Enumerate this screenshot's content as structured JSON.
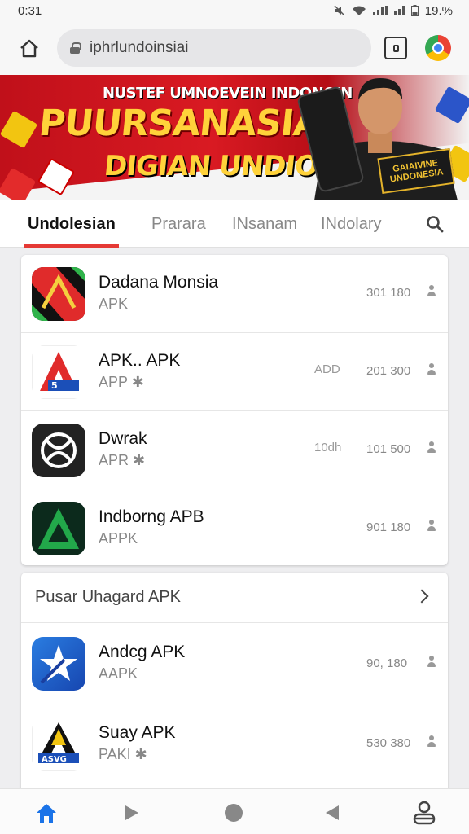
{
  "status_bar": {
    "time": "0:31",
    "battery": "19.%"
  },
  "browser": {
    "url": "iphrlundoinsiai"
  },
  "banner": {
    "line1": "NUSTEF UMNOEVEIN INDONOIN",
    "line2": "PUURSANASIA!",
    "line3": "DIGIAN UNDIOVEIN!",
    "badge": "GAIAIVINE UNDONESIA"
  },
  "tabs": [
    {
      "label": "Undolesian",
      "active": true
    },
    {
      "label": "Prarara",
      "active": false
    },
    {
      "label": "INsanam",
      "active": false
    },
    {
      "label": "INdolary",
      "active": false
    }
  ],
  "apps_card1": [
    {
      "name": "Dadana Monsia",
      "sub": "APK",
      "extra": "",
      "count": "301 180",
      "icon": "red-x-game-icon"
    },
    {
      "name": "APK.. APK",
      "sub": "APP ✱",
      "extra": "ADD",
      "count": "201 300",
      "icon": "red-a-logo-icon"
    },
    {
      "name": "Dwrak",
      "sub": "APR ✱",
      "extra": "10dh",
      "count": "101 500",
      "icon": "dark-swirl-logo-icon"
    },
    {
      "name": "Indborng APB",
      "sub": "APPK",
      "extra": "",
      "count": "901 180",
      "icon": "green-a-logo-icon"
    }
  ],
  "section2": {
    "title": "Pusar Uhagard APK"
  },
  "apps_card2": [
    {
      "name": "Andcg APK",
      "sub": "AAPK",
      "extra": "",
      "count": "90, 180",
      "icon": "blue-star-logo-icon"
    },
    {
      "name": "Suay APK",
      "sub": "PAKI ✱",
      "extra": "",
      "count": "530 380",
      "icon": "svg-a-logo-icon"
    }
  ],
  "colors": {
    "accent": "#e53935",
    "banner_red": "#d91a22",
    "banner_gold": "#ffd23a",
    "nav_blue": "#1a73e8"
  }
}
